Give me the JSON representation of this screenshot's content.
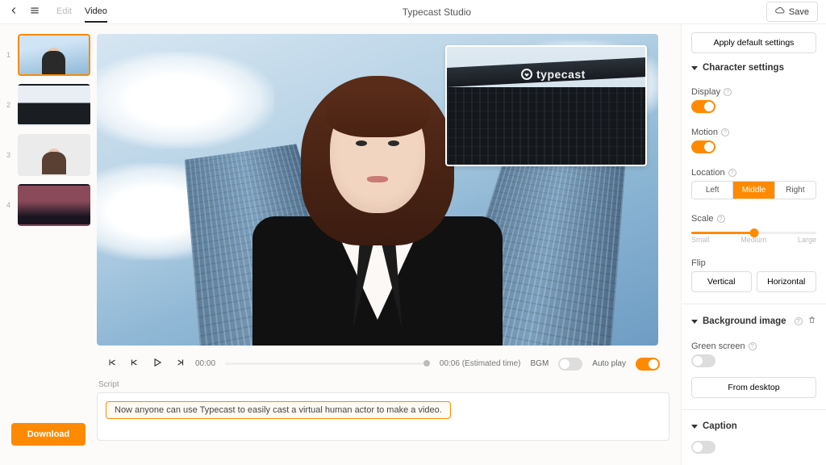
{
  "app_title": "Typecast Studio",
  "topbar": {
    "tabs": {
      "edit": "Edit",
      "video": "Video"
    },
    "save": "Save"
  },
  "thumbnails": {
    "count": 4,
    "numbers": [
      "1",
      "2",
      "3",
      "4"
    ],
    "selected": 1
  },
  "download": "Download",
  "pip_logo": "typecast",
  "player": {
    "time_current": "00:00",
    "time_end": "00:06",
    "estimated_suffix": "(Estimated time)",
    "bgm_label": "BGM",
    "bgm_on": false,
    "autoplay_label": "Auto play",
    "autoplay_on": true
  },
  "script": {
    "label": "Script",
    "line": "Now anyone can use Typecast to easily cast a virtual human actor to make a video."
  },
  "right": {
    "apply_default": "Apply default settings",
    "char_section": "Character settings",
    "display": "Display",
    "display_on": true,
    "motion": "Motion",
    "motion_on": true,
    "location": "Location",
    "loc_opts": {
      "left": "Left",
      "middle": "Middle",
      "right": "Right"
    },
    "loc_active": "middle",
    "scale": "Scale",
    "scale_labels": {
      "small": "Small",
      "medium": "Medium",
      "large": "Large"
    },
    "scale_value": 50,
    "flip": "Flip",
    "flip_v": "Vertical",
    "flip_h": "Horizontal",
    "bg_section": "Background image",
    "green": "Green screen",
    "green_on": false,
    "from_desktop": "From desktop",
    "caption_section": "Caption",
    "caption_on": false
  },
  "colors": {
    "accent": "#ff8a00"
  }
}
